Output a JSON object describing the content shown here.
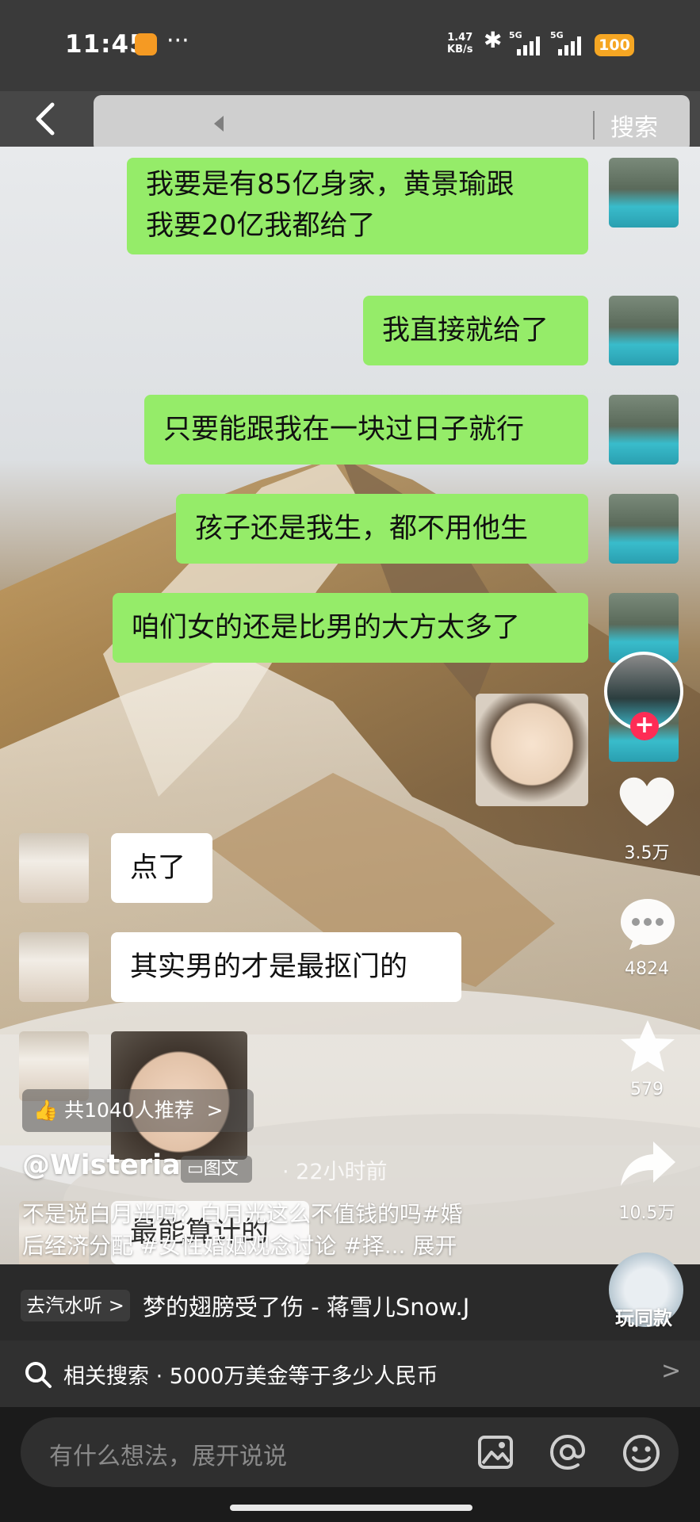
{
  "status_bar": {
    "time": "11:45",
    "more": "···",
    "net_speed_value": "1.47",
    "net_speed_unit": "KB/s",
    "signal1": "5G",
    "signal2": "5G",
    "battery": "100"
  },
  "header": {
    "search_button": "搜索"
  },
  "chat": {
    "sent": [
      "我要是有85亿身家，黄景瑜跟",
      "我要20亿我都给了",
      "我直接就给了",
      "只要能跟我在一块过日子就行",
      "孩子还是我生，都不用他生",
      "咱们女的还是比男的大方太多了"
    ],
    "received": [
      "点了",
      "其实男的才是最抠门的",
      "最能算计的"
    ]
  },
  "actions": {
    "likes": "3.5万",
    "comments": "4824",
    "favorites": "579",
    "shares": "10.5万"
  },
  "post": {
    "recommend": "共1040人推荐",
    "recommend_arrow": ">",
    "author": "@Wisteria",
    "type_tag": "图文",
    "time_ago": "· 22小时前",
    "desc_line1": "不是说白月光吗？白月光这么不值钱的吗#婚",
    "desc_line2": "后经济分配 #女性婚姻观念讨论 #择... 展开"
  },
  "music": {
    "go_listen": "去汽水听 >",
    "song": "梦的翅膀受了伤 - 蒋雪儿Snow.J",
    "play_same": "玩同款"
  },
  "related": {
    "text": "相关搜索 · 5000万美金等于多少人民币",
    "arrow": ">"
  },
  "comment_input": {
    "placeholder": "有什么想法，展开说说"
  }
}
